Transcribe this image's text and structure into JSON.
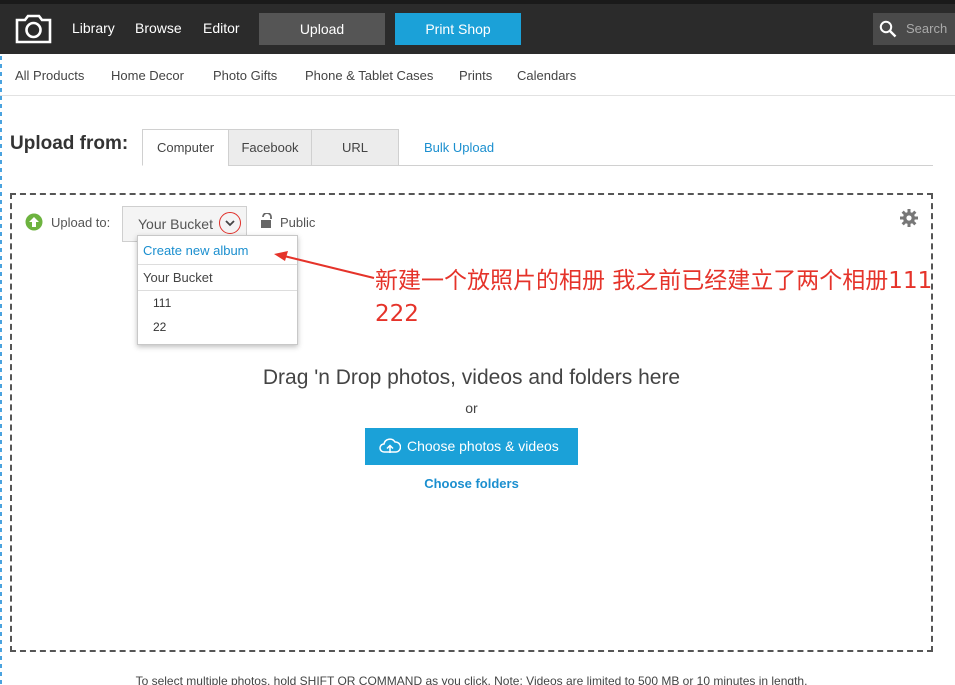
{
  "nav": {
    "library": "Library",
    "browse": "Browse",
    "editor": "Editor",
    "upload": "Upload",
    "print_shop": "Print Shop",
    "search_placeholder": "Search"
  },
  "subnav": [
    "All Products",
    "Home Decor",
    "Photo Gifts",
    "Phone & Tablet Cases",
    "Prints",
    "Calendars"
  ],
  "upload_from": {
    "label": "Upload from:",
    "tabs": [
      "Computer",
      "Facebook",
      "URL"
    ],
    "active_tab": "Computer",
    "bulk_upload": "Bulk Upload"
  },
  "upload_to": {
    "label": "Upload to:",
    "selected": "Your Bucket",
    "privacy": "Public"
  },
  "dropdown": {
    "create_new": "Create new album",
    "bucket": "Your Bucket",
    "albums": [
      "111",
      "22"
    ]
  },
  "annotation": {
    "text": "新建一个放照片的相册 我之前已经建立了两个相册111  222"
  },
  "dropzone": {
    "headline": "Drag 'n Drop photos, videos and folders here",
    "or": "or",
    "choose_button": "Choose photos & videos",
    "choose_folders": "Choose folders"
  },
  "footer": {
    "note": "To select multiple photos, hold SHIFT OR COMMAND as you click. Note: Videos are limited to 500 MB or 10 minutes in length."
  },
  "colors": {
    "accent": "#1ba1d8",
    "link": "#1b8fcf",
    "annotation": "#e5332a",
    "topbar": "#2b2b2b"
  }
}
